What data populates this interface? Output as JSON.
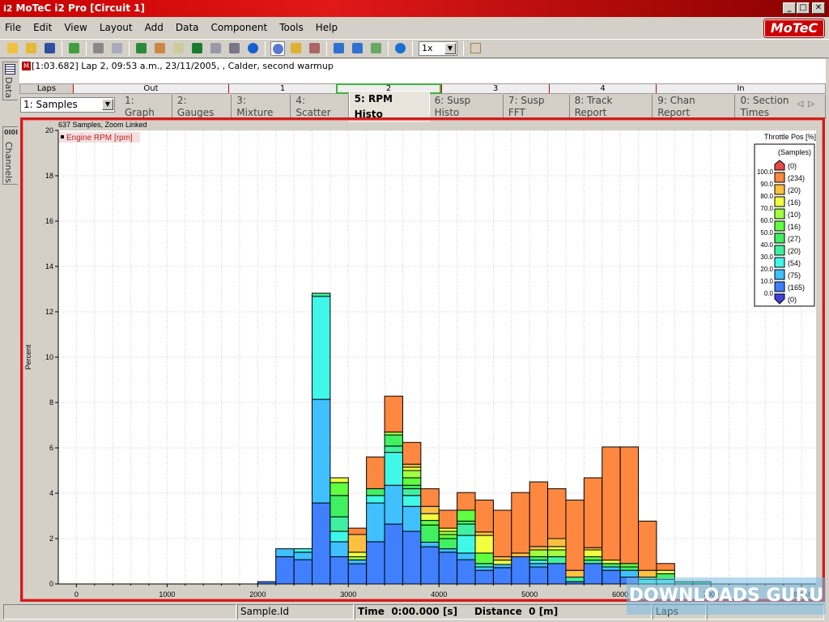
{
  "window": {
    "title": "MoTeC i2 Pro [Circuit 1]",
    "app_badge": "i2",
    "brand_logo": "MoTeC"
  },
  "menu": [
    {
      "label": "File"
    },
    {
      "label": "Edit"
    },
    {
      "label": "View"
    },
    {
      "label": "Layout"
    },
    {
      "label": "Add"
    },
    {
      "label": "Data"
    },
    {
      "label": "Component"
    },
    {
      "label": "Tools"
    },
    {
      "label": "Help"
    }
  ],
  "toolbar": {
    "icons": [
      "open-folder-icon",
      "close-folder-icon",
      "save-icon",
      "|",
      "download-arrow-icon",
      "|",
      "print-icon",
      "print-preview-icon",
      "|",
      "refresh-icon",
      "flags-icon",
      "edit-icon",
      "excel-icon",
      "calculator-icon",
      "list-icon",
      "info-icon",
      "|",
      "clock-icon",
      "layers-icon",
      "grid-icon",
      "|",
      "arrow-left-icon",
      "arrow-right-icon",
      "flag-icon",
      "|",
      "play-icon"
    ],
    "playback_speed": "1x"
  },
  "sidebar": {
    "data_tab": "Data",
    "channels_tab": "Channels",
    "channels_badge": "0I0I"
  },
  "info": {
    "badge": "M",
    "text": "[1:03.682] Lap 2, 09:53 a.m., 23/11/2005, , Calder, second warmup"
  },
  "laps": {
    "header": "Laps",
    "items": [
      "Out",
      "1",
      "2",
      "3",
      "4",
      "In"
    ],
    "selected": "2"
  },
  "worksheet_select": "1: Samples",
  "tabs": [
    "1: Graph",
    "2: Gauges",
    "3: Mixture",
    "4: Scatter",
    "5: RPM Histo",
    "6: Susp Histo",
    "7: Susp FFT",
    "8: Track Report",
    "9: Chan Report",
    "0: Section Times"
  ],
  "active_tab": "5: RPM Histo",
  "chart_data": {
    "type": "bar",
    "stacked": true,
    "header": "637 Samples, Zoom Linked",
    "title": "Engine RPM [rpm]",
    "ylabel": "Percent",
    "xlabel": "",
    "xlim": [
      -200,
      8160
    ],
    "ylim": [
      0,
      20
    ],
    "xticks": [
      0,
      1000,
      2000,
      3000,
      4000,
      5000,
      6000,
      7000,
      8000
    ],
    "yticks": [
      0,
      2,
      4,
      6,
      8,
      10,
      12,
      14,
      16,
      18,
      20
    ],
    "grid": true,
    "bin_width": 200,
    "legend": {
      "title": "Throttle Pos [%]",
      "subtitle": "(Samples)",
      "placement": "top-right",
      "levels": [
        "100.0",
        "90.0",
        "80.0",
        "70.0",
        "60.0",
        "50.0",
        "40.0",
        "30.0",
        "20.0",
        "10.0",
        "0.0"
      ],
      "counts": [
        "(0)",
        "(234)",
        "(20)",
        "(16)",
        "(10)",
        "(16)",
        "(27)",
        "(20)",
        "(54)",
        "(75)",
        "(165)",
        "(0)"
      ],
      "colors": [
        "#e84848",
        "#ff8840",
        "#ffc040",
        "#f0ff40",
        "#a0ff40",
        "#60ff40",
        "#40f060",
        "#40f0a0",
        "#40f8e8",
        "#40c0ff",
        "#4080ff",
        "#4040e0"
      ]
    },
    "band_colors": [
      "#4080ff",
      "#40c0ff",
      "#40f8e8",
      "#40f0a0",
      "#40f060",
      "#60ff40",
      "#a0ff40",
      "#f0ff40",
      "#ffc040",
      "#ff8840"
    ],
    "band_names": [
      "0-10",
      "10-20",
      "20-30",
      "30-40",
      "40-50",
      "50-60",
      "60-70",
      "70-80",
      "80-90",
      "90-100"
    ],
    "bins": [
      {
        "x": 2000,
        "stack": [
          0.1,
          0,
          0,
          0,
          0,
          0,
          0,
          0,
          0,
          0
        ]
      },
      {
        "x": 2200,
        "stack": [
          1.2,
          0.35,
          0,
          0,
          0,
          0,
          0,
          0,
          0,
          0
        ]
      },
      {
        "x": 2400,
        "stack": [
          1.07,
          0.33,
          0.15,
          0,
          0,
          0,
          0,
          0,
          0,
          0
        ]
      },
      {
        "x": 2600,
        "stack": [
          3.57,
          4.57,
          4.54,
          0.14,
          0,
          0,
          0,
          0,
          0,
          0
        ]
      },
      {
        "x": 2800,
        "stack": [
          1.2,
          0.66,
          0.46,
          0.64,
          0.94,
          0.57,
          0,
          0.21,
          0,
          0
        ]
      },
      {
        "x": 3000,
        "stack": [
          0.89,
          0.17,
          0,
          0,
          0,
          0,
          0.14,
          0.2,
          0.78,
          0.28
        ]
      },
      {
        "x": 3200,
        "stack": [
          1.86,
          1.71,
          0.33,
          0,
          0.3,
          0,
          0,
          0,
          0,
          1.4
        ]
      },
      {
        "x": 3400,
        "stack": [
          2.64,
          1.71,
          1.45,
          0.28,
          0.49,
          0,
          0.13,
          0,
          0,
          1.58
        ]
      },
      {
        "x": 3600,
        "stack": [
          2.32,
          1.1,
          0.48,
          0.3,
          0.15,
          0.33,
          0.32,
          0.15,
          0.13,
          0.96
        ]
      },
      {
        "x": 3800,
        "stack": [
          1.64,
          0.2,
          0,
          0,
          0.76,
          0.2,
          0,
          0.3,
          0.32,
          0.78
        ]
      },
      {
        "x": 4000,
        "stack": [
          1.4,
          0.15,
          0,
          0,
          0.45,
          0.18,
          0.14,
          0.14,
          0,
          0.79
        ]
      },
      {
        "x": 4200,
        "stack": [
          1.07,
          0.29,
          0.78,
          0.5,
          0.13,
          0.48,
          0,
          0,
          0,
          0.78
        ]
      },
      {
        "x": 4400,
        "stack": [
          0.6,
          0.15,
          0,
          0.15,
          0,
          0.46,
          0,
          0.78,
          0.15,
          1.41
        ]
      },
      {
        "x": 4600,
        "stack": [
          0.72,
          0.14,
          0,
          0,
          0,
          0,
          0,
          0.19,
          0.15,
          2.05
        ]
      },
      {
        "x": 4800,
        "stack": [
          1.2,
          0,
          0,
          0,
          0,
          0,
          0,
          0,
          0.16,
          2.67
        ]
      },
      {
        "x": 5000,
        "stack": [
          0.75,
          0.15,
          0.15,
          0,
          0.15,
          0,
          0.3,
          0,
          0.15,
          2.85
        ]
      },
      {
        "x": 5200,
        "stack": [
          0.9,
          0,
          0,
          0.3,
          0,
          0,
          0.3,
          0.15,
          0.35,
          2.2
        ]
      },
      {
        "x": 5400,
        "stack": [
          0.1,
          0,
          0,
          0.2,
          0,
          0,
          0,
          0,
          0.3,
          3.1
        ]
      },
      {
        "x": 5600,
        "stack": [
          0.9,
          0,
          0,
          0.15,
          0,
          0.15,
          0,
          0.3,
          0.1,
          3.08
        ]
      },
      {
        "x": 5800,
        "stack": [
          0.6,
          0.15,
          0,
          0,
          0.15,
          0,
          0,
          0.15,
          0,
          4.99
        ]
      },
      {
        "x": 6000,
        "stack": [
          0.3,
          0.3,
          0,
          0,
          0.15,
          0.15,
          0,
          0,
          0,
          5.14
        ]
      },
      {
        "x": 6200,
        "stack": [
          0,
          0,
          0.2,
          0.1,
          0,
          0,
          0,
          0,
          0.3,
          2.17
        ]
      },
      {
        "x": 6400,
        "stack": [
          0,
          0,
          0.2,
          0,
          0.25,
          0,
          0,
          0.15,
          0,
          0.3
        ]
      },
      {
        "x": 6600,
        "stack": [
          0,
          0,
          0,
          0.1,
          0,
          0,
          0,
          0,
          0,
          0
        ]
      },
      {
        "x": 6800,
        "stack": [
          0,
          0,
          0,
          0.1,
          0,
          0,
          0,
          0,
          0,
          0
        ]
      }
    ]
  },
  "status": {
    "sample_label": "Sample.Id",
    "time_label": "Time",
    "time_value": "0:00.000 [s]",
    "distance_label": "Distance",
    "distance_value": "0 [m]",
    "laps_label": "Laps"
  },
  "watermark": "DOWNLOADS GURU"
}
